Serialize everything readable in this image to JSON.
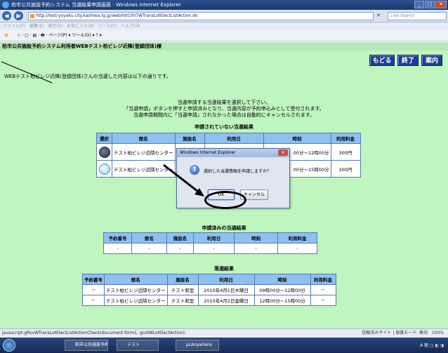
{
  "browser": {
    "window_title": "柏市公共施設予約システム 当選結果申請画面 - Windows Internet Explorer",
    "url": "http://test-yoyaku.city.kashiwa.lg.jp/web/lotC007WTransLotElectListAction.do",
    "search_placeholder": "Live Search",
    "menu": "ファイル(F)  編集(E)  表示(V)  お気に入り(A)  ツール(T)  ヘルプ(H)",
    "toolbar_items": "☆ ·  ▢ · ▤ · 🖶 · ページ(P) ▾  ツール(O) ▾  ? ▾",
    "status_text": "javascript:gRsvWTransLotElectListActionCheck(document.form1, gLotWLotElectAction);",
    "status_zone": "信頼済みサイト | 保護モード: 無効",
    "zoom": "100%",
    "taskbar_items": [
      "柏市公共施設予約...",
      "テスト",
      "pcAnywhere"
    ]
  },
  "page": {
    "header_title": "柏市公共施設予約システム利用者WEBテスト柏ビレジ近隣(登録団体)様",
    "buttons": {
      "back": "もどる",
      "end": "終了",
      "guide": "案内"
    },
    "intro": "WEBテスト柏ビレジ近隣(登録団体)さんの当選した内容は以下の通りです。",
    "notice": [
      "当選申請する当選結果を選択して下さい。",
      "「当選申請」ボタンを押すと申請済みとなり、当選内容が予約申込みとして受付されます。",
      "当選申請期間内に「当選申請」されなかった場合は自動的にキャンセルされます。"
    ]
  },
  "unapplied": {
    "title": "申請されていない当選結果",
    "headers": [
      "選択",
      "館名",
      "施設名",
      "利用日",
      "時刻",
      "利用料金"
    ],
    "rows": [
      {
        "hall": "テスト柏ビレジ近隣センター",
        "facility": "",
        "date": "",
        "time": "00分〜12時00分",
        "fee": "300円"
      },
      {
        "hall": "テスト柏ビレジ近隣センター",
        "facility": "",
        "date": "",
        "time": "00分〜15時00分",
        "fee": "300円"
      }
    ]
  },
  "applied": {
    "title": "申請済みの当選結果",
    "headers": [
      "予約番号",
      "館名",
      "施設名",
      "利用日",
      "時刻",
      "利用料金"
    ],
    "rows": [
      [
        "-",
        "-",
        "-",
        "-",
        "-",
        "-"
      ]
    ]
  },
  "lost": {
    "title": "落選結果",
    "headers": [
      "予約番号",
      "館名",
      "施設名",
      "利用日",
      "時刻",
      "利用料金"
    ],
    "rows": [
      [
        "−",
        "テスト柏ビレジ近隣センター",
        "テスト和室",
        "2010年4月1日木曜日",
        "09時00分〜12時00分",
        "−"
      ],
      [
        "−",
        "テスト柏ビレジ近隣センター",
        "テスト和室",
        "2010年4月2日金曜日",
        "12時00分〜15時00分",
        "−"
      ]
    ]
  },
  "dialog": {
    "title": "Windows Internet Explorer",
    "message": "選択した当選情報を申請しますか？",
    "ok": "OK",
    "cancel": "キャンセル"
  }
}
